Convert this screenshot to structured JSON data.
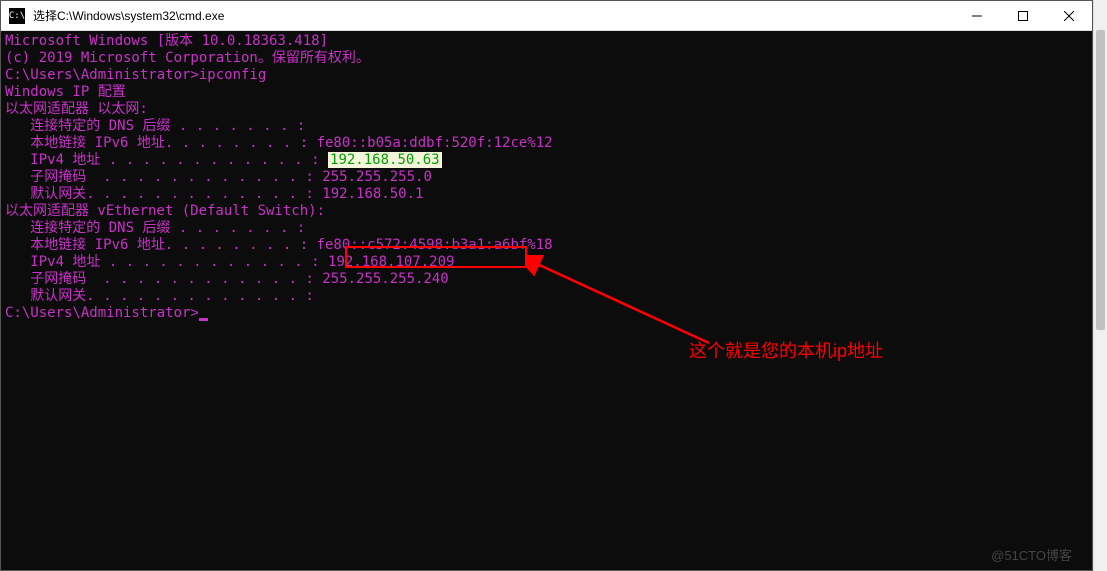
{
  "window": {
    "title": "选择C:\\Windows\\system32\\cmd.exe",
    "icon_label": "C:\\"
  },
  "terminal": {
    "line1": "Microsoft Windows [版本 10.0.18363.418]",
    "line2": "(c) 2019 Microsoft Corporation。保留所有权利。",
    "blank": "",
    "prompt1": "C:\\Users\\Administrator>ipconfig",
    "header": "Windows IP 配置",
    "adapter1_title": "以太网适配器 以太网:",
    "a1_dns": "   连接特定的 DNS 后缀 . . . . . . . :",
    "a1_ipv6_l": "   本地链接 IPv6 地址. . . . . . . . : ",
    "a1_ipv6_v": "fe80::b05a:ddbf:520f:12ce%12",
    "a1_ipv4_l": "   IPv4 地址 . . . . . . . . . . . . : ",
    "a1_ipv4_v": "192.168.50.63",
    "a1_mask_l": "   子网掩码  . . . . . . . . . . . . : ",
    "a1_mask_v": "255.255.255.0",
    "a1_gw_l": "   默认网关. . . . . . . . . . . . . : ",
    "a1_gw_v": "192.168.50.1",
    "adapter2_title": "以太网适配器 vEthernet (Default Switch):",
    "a2_dns": "   连接特定的 DNS 后缀 . . . . . . . :",
    "a2_ipv6_l": "   本地链接 IPv6 地址. . . . . . . . : ",
    "a2_ipv6_v": "fe80::c572:4598:b3a1:a6bf%18",
    "a2_ipv4_l": "   IPv4 地址 . . . . . . . . . . . . : ",
    "a2_ipv4_v": "192.168.107.209",
    "a2_mask_l": "   子网掩码  . . . . . . . . . . . . : ",
    "a2_mask_v": "255.255.255.240",
    "a2_gw": "   默认网关. . . . . . . . . . . . . :",
    "prompt2": "C:\\Users\\Administrator>"
  },
  "annotation": {
    "text": "这个就是您的本机ip地址"
  },
  "watermark": "@51CTO博客"
}
